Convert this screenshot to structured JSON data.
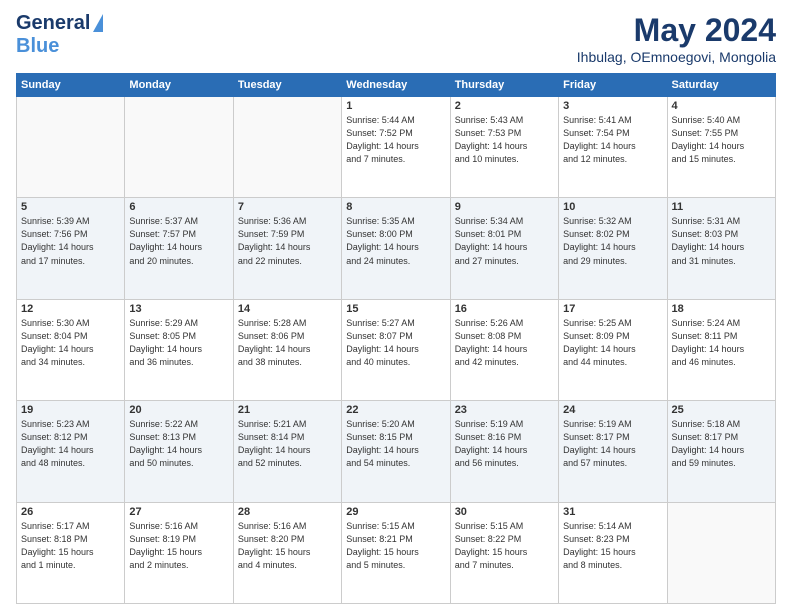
{
  "logo": {
    "line1": "General",
    "line2": "Blue"
  },
  "header": {
    "month": "May 2024",
    "location": "Ihbulag, OEmnoegovi, Mongolia"
  },
  "days_of_week": [
    "Sunday",
    "Monday",
    "Tuesday",
    "Wednesday",
    "Thursday",
    "Friday",
    "Saturday"
  ],
  "weeks": [
    [
      {
        "day": "",
        "info": ""
      },
      {
        "day": "",
        "info": ""
      },
      {
        "day": "",
        "info": ""
      },
      {
        "day": "1",
        "info": "Sunrise: 5:44 AM\nSunset: 7:52 PM\nDaylight: 14 hours\nand 7 minutes."
      },
      {
        "day": "2",
        "info": "Sunrise: 5:43 AM\nSunset: 7:53 PM\nDaylight: 14 hours\nand 10 minutes."
      },
      {
        "day": "3",
        "info": "Sunrise: 5:41 AM\nSunset: 7:54 PM\nDaylight: 14 hours\nand 12 minutes."
      },
      {
        "day": "4",
        "info": "Sunrise: 5:40 AM\nSunset: 7:55 PM\nDaylight: 14 hours\nand 15 minutes."
      }
    ],
    [
      {
        "day": "5",
        "info": "Sunrise: 5:39 AM\nSunset: 7:56 PM\nDaylight: 14 hours\nand 17 minutes."
      },
      {
        "day": "6",
        "info": "Sunrise: 5:37 AM\nSunset: 7:57 PM\nDaylight: 14 hours\nand 20 minutes."
      },
      {
        "day": "7",
        "info": "Sunrise: 5:36 AM\nSunset: 7:59 PM\nDaylight: 14 hours\nand 22 minutes."
      },
      {
        "day": "8",
        "info": "Sunrise: 5:35 AM\nSunset: 8:00 PM\nDaylight: 14 hours\nand 24 minutes."
      },
      {
        "day": "9",
        "info": "Sunrise: 5:34 AM\nSunset: 8:01 PM\nDaylight: 14 hours\nand 27 minutes."
      },
      {
        "day": "10",
        "info": "Sunrise: 5:32 AM\nSunset: 8:02 PM\nDaylight: 14 hours\nand 29 minutes."
      },
      {
        "day": "11",
        "info": "Sunrise: 5:31 AM\nSunset: 8:03 PM\nDaylight: 14 hours\nand 31 minutes."
      }
    ],
    [
      {
        "day": "12",
        "info": "Sunrise: 5:30 AM\nSunset: 8:04 PM\nDaylight: 14 hours\nand 34 minutes."
      },
      {
        "day": "13",
        "info": "Sunrise: 5:29 AM\nSunset: 8:05 PM\nDaylight: 14 hours\nand 36 minutes."
      },
      {
        "day": "14",
        "info": "Sunrise: 5:28 AM\nSunset: 8:06 PM\nDaylight: 14 hours\nand 38 minutes."
      },
      {
        "day": "15",
        "info": "Sunrise: 5:27 AM\nSunset: 8:07 PM\nDaylight: 14 hours\nand 40 minutes."
      },
      {
        "day": "16",
        "info": "Sunrise: 5:26 AM\nSunset: 8:08 PM\nDaylight: 14 hours\nand 42 minutes."
      },
      {
        "day": "17",
        "info": "Sunrise: 5:25 AM\nSunset: 8:09 PM\nDaylight: 14 hours\nand 44 minutes."
      },
      {
        "day": "18",
        "info": "Sunrise: 5:24 AM\nSunset: 8:11 PM\nDaylight: 14 hours\nand 46 minutes."
      }
    ],
    [
      {
        "day": "19",
        "info": "Sunrise: 5:23 AM\nSunset: 8:12 PM\nDaylight: 14 hours\nand 48 minutes."
      },
      {
        "day": "20",
        "info": "Sunrise: 5:22 AM\nSunset: 8:13 PM\nDaylight: 14 hours\nand 50 minutes."
      },
      {
        "day": "21",
        "info": "Sunrise: 5:21 AM\nSunset: 8:14 PM\nDaylight: 14 hours\nand 52 minutes."
      },
      {
        "day": "22",
        "info": "Sunrise: 5:20 AM\nSunset: 8:15 PM\nDaylight: 14 hours\nand 54 minutes."
      },
      {
        "day": "23",
        "info": "Sunrise: 5:19 AM\nSunset: 8:16 PM\nDaylight: 14 hours\nand 56 minutes."
      },
      {
        "day": "24",
        "info": "Sunrise: 5:19 AM\nSunset: 8:17 PM\nDaylight: 14 hours\nand 57 minutes."
      },
      {
        "day": "25",
        "info": "Sunrise: 5:18 AM\nSunset: 8:17 PM\nDaylight: 14 hours\nand 59 minutes."
      }
    ],
    [
      {
        "day": "26",
        "info": "Sunrise: 5:17 AM\nSunset: 8:18 PM\nDaylight: 15 hours\nand 1 minute."
      },
      {
        "day": "27",
        "info": "Sunrise: 5:16 AM\nSunset: 8:19 PM\nDaylight: 15 hours\nand 2 minutes."
      },
      {
        "day": "28",
        "info": "Sunrise: 5:16 AM\nSunset: 8:20 PM\nDaylight: 15 hours\nand 4 minutes."
      },
      {
        "day": "29",
        "info": "Sunrise: 5:15 AM\nSunset: 8:21 PM\nDaylight: 15 hours\nand 5 minutes."
      },
      {
        "day": "30",
        "info": "Sunrise: 5:15 AM\nSunset: 8:22 PM\nDaylight: 15 hours\nand 7 minutes."
      },
      {
        "day": "31",
        "info": "Sunrise: 5:14 AM\nSunset: 8:23 PM\nDaylight: 15 hours\nand 8 minutes."
      },
      {
        "day": "",
        "info": ""
      }
    ]
  ]
}
